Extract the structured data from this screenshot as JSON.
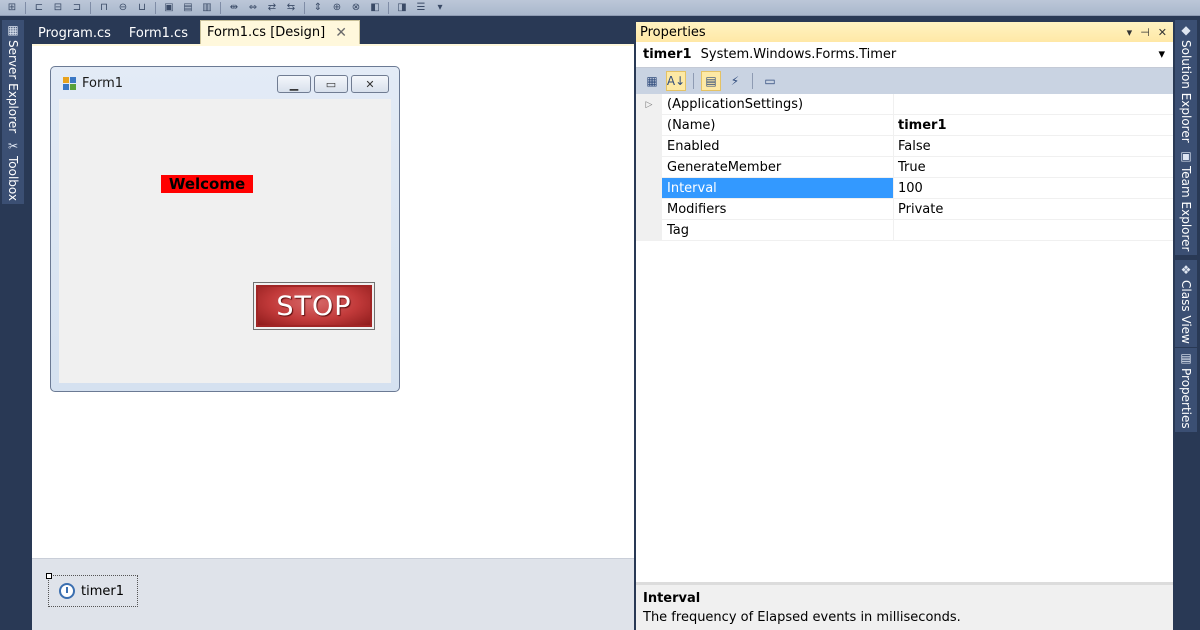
{
  "toolbar": {
    "icons": [
      "align-icon",
      "align-left-icon",
      "align-center-icon",
      "align-right-icon",
      "align-top-icon",
      "align-middle-icon",
      "align-bottom-icon",
      "make-same-size-icon",
      "make-same-width-icon",
      "make-same-height-icon",
      "horizontal-spacing-icon",
      "increase-spacing-icon",
      "decrease-spacing-icon",
      "remove-spacing-icon",
      "vertical-spacing-icon",
      "center-horizontally-icon",
      "center-vertically-icon",
      "bring-to-front-icon",
      "send-to-back-icon",
      "tab-order-icon",
      "overflow-dropdown-icon"
    ]
  },
  "left_tabs": {
    "server_explorer": "Server Explorer",
    "toolbox": "Toolbox"
  },
  "right_tabs": {
    "solution_explorer": "Solution Explorer",
    "team_explorer": "Team Explorer",
    "class_view": "Class View",
    "properties": "Properties"
  },
  "doc_tabs": [
    {
      "label": "Program.cs"
    },
    {
      "label": "Form1.cs"
    },
    {
      "label": "Form1.cs [Design]",
      "active": true
    }
  ],
  "form": {
    "title": "Form1",
    "welcome_label": "Welcome",
    "stop_button": "STOP"
  },
  "tray": {
    "component": "timer1"
  },
  "properties": {
    "panel_title": "Properties",
    "object_name": "timer1",
    "object_type": "System.Windows.Forms.Timer",
    "rows": [
      {
        "name": "(ApplicationSettings)",
        "value": "",
        "expandable": true
      },
      {
        "name": "(Name)",
        "value": "timer1",
        "bold_value": true
      },
      {
        "name": "Enabled",
        "value": "False"
      },
      {
        "name": "GenerateMember",
        "value": "True"
      },
      {
        "name": "Interval",
        "value": "100",
        "selected": true
      },
      {
        "name": "Modifiers",
        "value": "Private"
      },
      {
        "name": "Tag",
        "value": ""
      }
    ],
    "description": {
      "title": "Interval",
      "text": "The frequency of Elapsed events in milliseconds."
    }
  },
  "colors": {
    "ide_background": "#293955",
    "welcome_back": "#ff0000",
    "selected_row": "#3399ff",
    "active_tab": "#fff8dc"
  }
}
